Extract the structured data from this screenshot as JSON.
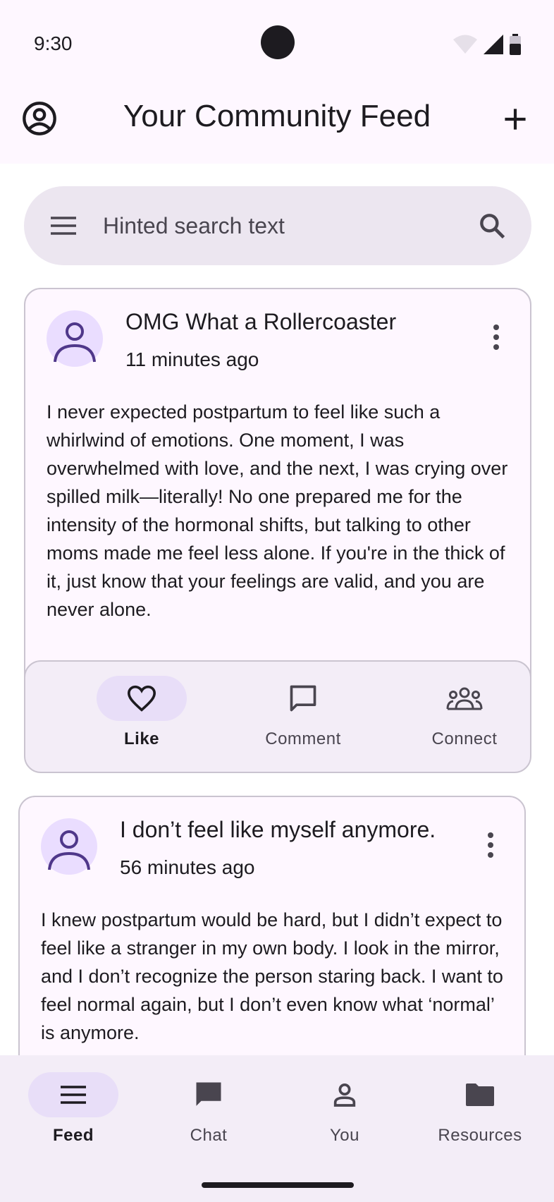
{
  "status_bar": {
    "time": "9:30"
  },
  "app_bar": {
    "title": "Your Community Feed"
  },
  "search": {
    "placeholder": "Hinted search text"
  },
  "posts": [
    {
      "title": "OMG What a Rollercoaster",
      "time": "11 minutes ago",
      "body": "I never expected postpartum to feel like such a whirlwind of emotions. One moment, I was overwhelmed with love, and the next, I was crying over spilled milk—literally! No one prepared me for the intensity of the hormonal shifts, but talking to other moms made me feel less alone. If you're in the thick of it, just know that your feelings are valid, and you are never alone.",
      "actions": {
        "like": "Like",
        "comment": "Comment",
        "connect": "Connect"
      }
    },
    {
      "title": "I don’t feel like myself anymore.",
      "time": "56 minutes ago",
      "body": "I knew postpartum would be hard, but I didn’t expect to feel like a stranger in my own body. I look in the mirror, and I don’t recognize the person staring back. I want to feel normal again, but I don’t even know what ‘normal’ is anymore."
    }
  ],
  "bottom_nav": {
    "feed": "Feed",
    "chat": "Chat",
    "you": "You",
    "resources": "Resources"
  },
  "colors": {
    "surface": "#FEF7FF",
    "surface_container": "#F3EDF7",
    "search_container": "#ECE6F0",
    "secondary_container": "#E8DEF8",
    "primary_container": "#EADDFF",
    "primary": "#4F378A",
    "on_surface": "#1D1B20",
    "on_surface_variant": "#49454F",
    "outline_variant": "#CAC4D0"
  },
  "icons": {
    "app_bar_left": "account-circle-icon",
    "app_bar_right": "add-icon",
    "search_left": "menu-icon",
    "search_right": "search-icon",
    "post_avatar": "person-icon",
    "post_menu": "more-vert-icon",
    "like": "heart-icon",
    "comment": "comment-icon",
    "connect": "groups-icon",
    "nav_feed": "menu-icon",
    "nav_chat": "chat-icon",
    "nav_you": "person-icon",
    "nav_resources": "folder-icon"
  }
}
